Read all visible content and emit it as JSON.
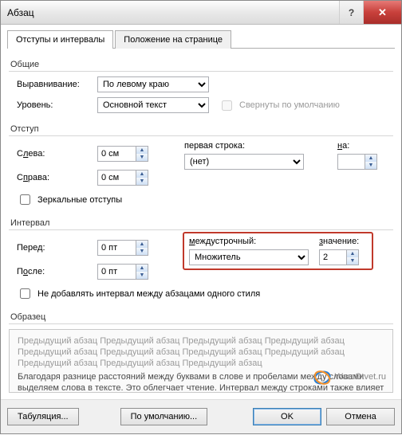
{
  "window": {
    "title": "Абзац"
  },
  "tabs": {
    "indents": "Отступы и интервалы",
    "position": "Положение на странице"
  },
  "groups": {
    "general": "Общие",
    "indent": "Отступ",
    "spacing": "Интервал",
    "preview": "Образец"
  },
  "general": {
    "alignment_label": "Выравнивание:",
    "alignment_value": "По левому краю",
    "level_label": "Уровень:",
    "level_value": "Основной текст",
    "collapse_label": "Свернуты по умолчанию"
  },
  "indent": {
    "left_label": "Слева:",
    "left_value": "0 см",
    "right_label": "Справа:",
    "right_value": "0 см",
    "first_line_label": "первая строка:",
    "first_line_value": "(нет)",
    "by_label": "на:",
    "by_value": "",
    "mirror_label": "Зеркальные отступы"
  },
  "spacing": {
    "before_label": "Перед:",
    "before_value": "0 пт",
    "after_label": "После:",
    "after_value": "0 пт",
    "line_spacing_label": "междустрочный:",
    "line_spacing_value": "Множитель",
    "at_label": "значение:",
    "at_value": "2",
    "no_space_label": "Не добавлять интервал между абзацами одного стиля"
  },
  "preview": {
    "prev_para": "Предыдущий абзац Предыдущий абзац Предыдущий абзац Предыдущий абзац Предыдущий абзац Предыдущий абзац Предыдущий абзац Предыдущий абзац Предыдущий абзац Предыдущий абзац Предыдущий абзац",
    "sample": "Благодаря разнице расстояний между буквами в слове и пробелами между словами выделяем слова в тексте. Это облегчает чтение. Интервал между строками также влияет на скорость восприятия текста."
  },
  "buttons": {
    "tabs": "Табуляция...",
    "default": "По умолчанию...",
    "ok": "OK",
    "cancel": "Отмена"
  },
  "watermark": "WamOtvet.ru"
}
